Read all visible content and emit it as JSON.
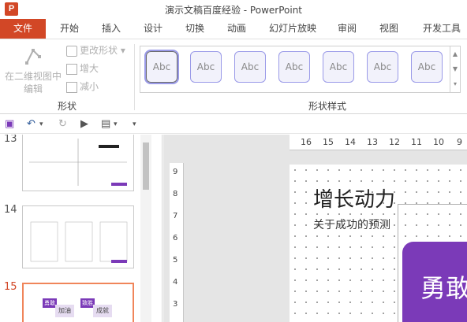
{
  "window": {
    "title": "演示文稿百度经验 - PowerPoint",
    "app_icon": "P"
  },
  "tabs": [
    "文件",
    "开始",
    "插入",
    "设计",
    "切换",
    "动画",
    "幻灯片放映",
    "审阅",
    "视图",
    "开发工具"
  ],
  "ribbon": {
    "edit_shape_label_1": "在二维视图中",
    "edit_shape_label_2": "编辑",
    "change_shape": "更改形状",
    "increase": "增大",
    "decrease": "减小",
    "group_shape": "形状",
    "group_shape_styles": "形状样式",
    "gallery_items": [
      "Abc",
      "Abc",
      "Abc",
      "Abc",
      "Abc",
      "Abc",
      "Abc"
    ]
  },
  "qat": {
    "save": "💾",
    "undo": "↶",
    "redo": "↻",
    "present": "▶",
    "more": "▾"
  },
  "thumbnails": [
    {
      "number": "13"
    },
    {
      "number": "14"
    },
    {
      "number": "15"
    }
  ],
  "thumb15": {
    "a": "勇敢",
    "b": "加油",
    "c": "致胜",
    "d": "成就"
  },
  "ruler": {
    "h_ticks": [
      "16",
      "15",
      "14",
      "13",
      "12",
      "11",
      "10",
      "9"
    ],
    "v_ticks": [
      "9",
      "8",
      "7",
      "6",
      "5",
      "4",
      "3"
    ]
  },
  "slide": {
    "title": "增长动力",
    "subtitle": "关于成功的预测",
    "box_text": "勇敢"
  },
  "colors": {
    "accent": "#d24726",
    "purple": "#7b3ab8",
    "gallery_border": "#9a9ae8"
  }
}
